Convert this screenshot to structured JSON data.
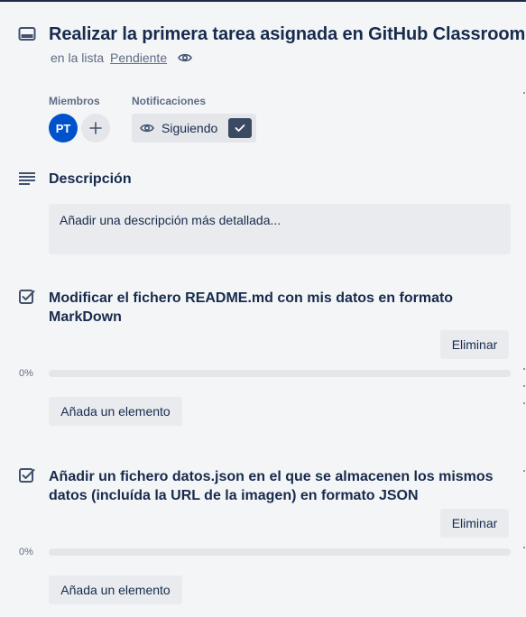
{
  "card": {
    "title": "Realizar la primera tarea asignada en GitHub Classroom",
    "list_prefix": "en la lista",
    "list_name": "Pendiente"
  },
  "members": {
    "label": "Miembros",
    "avatar_initials": "PT"
  },
  "notifications": {
    "label": "Notificaciones",
    "follow_label": "Siguiendo"
  },
  "description": {
    "title": "Descripción",
    "placeholder": "Añadir una descripción más detallada..."
  },
  "checklists": [
    {
      "title": "Modificar el fichero README.md con mis datos en formato MarkDown",
      "delete_label": "Eliminar",
      "progress": "0%",
      "progress_value": 0,
      "add_item_label": "Añada un elemento"
    },
    {
      "title": "Añadir un fichero datos.json en el que se almacenen los mismos datos (incluída la URL de la imagen) en formato JSON",
      "delete_label": "Eliminar",
      "progress": "0%",
      "progress_value": 0,
      "add_item_label": "Añada un elemento"
    }
  ],
  "icons": {
    "card": "card-icon",
    "watch": "eye-icon",
    "add": "plus-icon",
    "check": "checkmark-icon",
    "description": "description-lines-icon",
    "checklist": "checklist-icon"
  },
  "colors": {
    "avatar": "#0052cc",
    "text": "#172b4d",
    "muted": "#5e6c84",
    "button": "#e9ebee",
    "check_bg": "#3b4a63"
  }
}
